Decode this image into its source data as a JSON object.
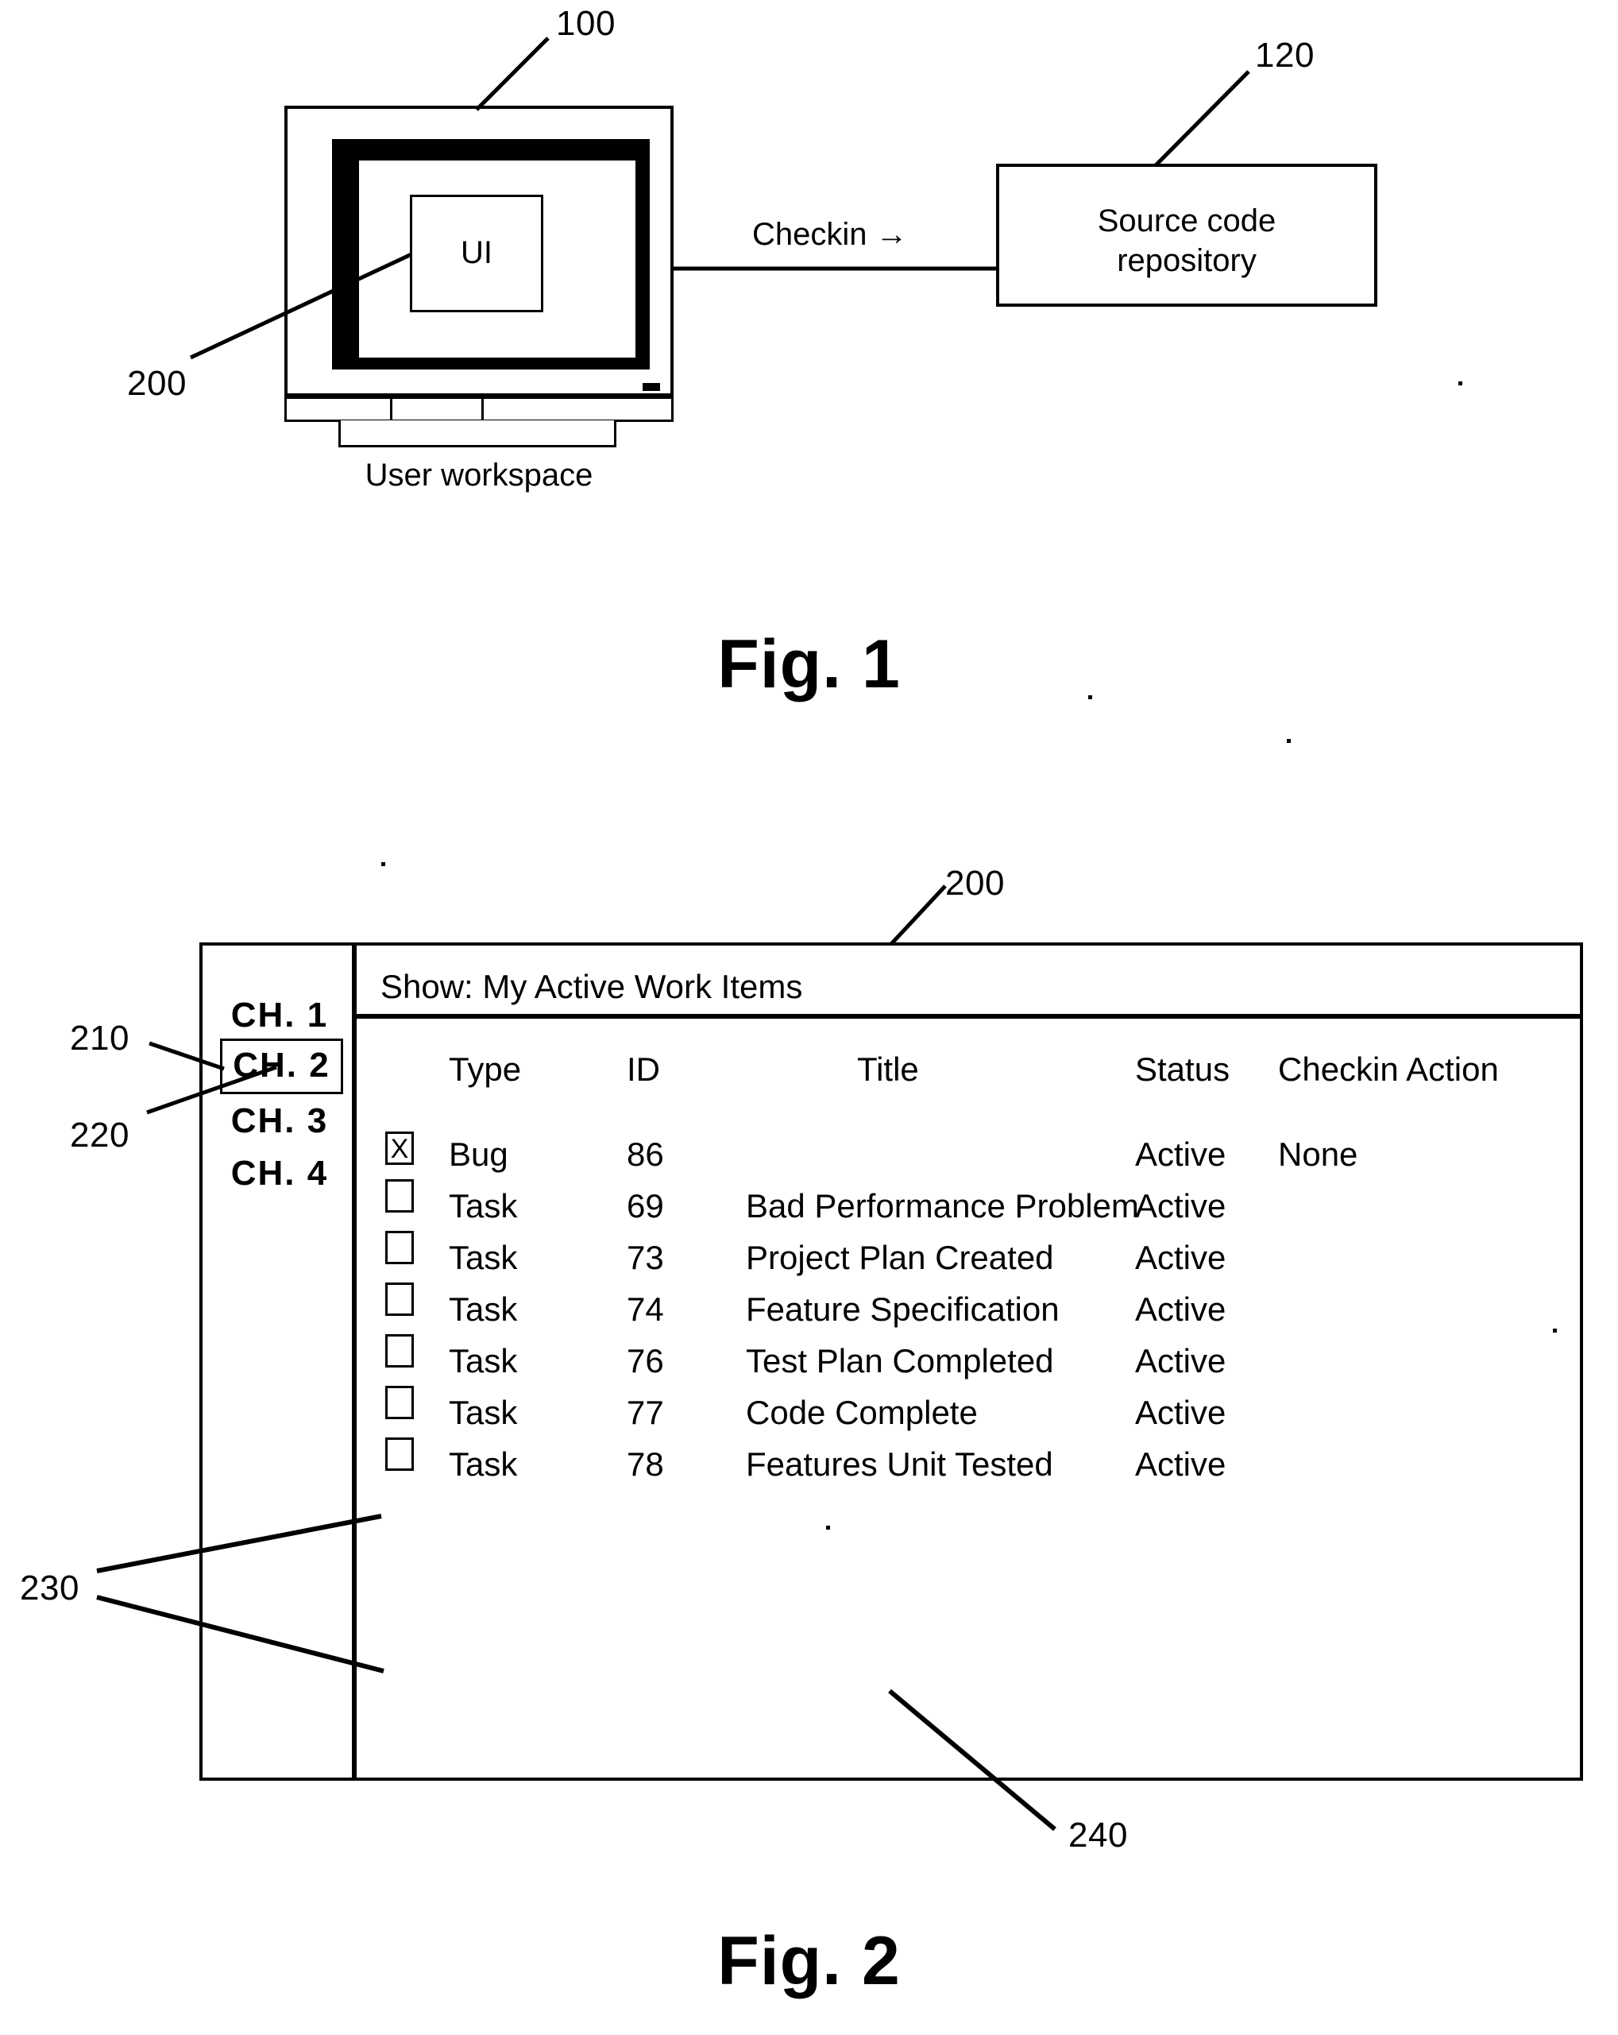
{
  "figures": [
    {
      "id": "fig-1",
      "caption": "Fig. 1",
      "reference_numbers": [
        "100",
        "120",
        "200"
      ],
      "nodes": {
        "workspace": {
          "ref": "100",
          "screen_label": "UI",
          "screen_ref": "200",
          "caption": "User workspace"
        },
        "repository": {
          "ref": "120",
          "line1": "Source code",
          "line2": "repository"
        },
        "connector": {
          "label": "Checkin →"
        }
      }
    },
    {
      "id": "fig-2",
      "caption": "Fig. 2",
      "reference_numbers": [
        "200",
        "210",
        "220",
        "230",
        "240"
      ],
      "window": {
        "ref": "200",
        "sidebar": {
          "ref_selected_box": "210",
          "ref_selected_item": "220",
          "items": [
            {
              "label": "CH. 1",
              "selected": false
            },
            {
              "label": "CH. 2",
              "selected": true
            },
            {
              "label": "CH. 3",
              "selected": false
            },
            {
              "label": "CH. 4",
              "selected": false
            }
          ]
        },
        "show_bar": {
          "text": "Show: My Active Work Items"
        },
        "table": {
          "ref_checkbox_column": "230",
          "ref_title_cell": "240",
          "columns": [
            "Type",
            "ID",
            "Title",
            "Status",
            "Checkin Action"
          ],
          "rows": [
            {
              "checked": true,
              "check_mark": "X",
              "type": "Bug",
              "id": "86",
              "title": "",
              "status": "Active",
              "action": "None"
            },
            {
              "checked": false,
              "check_mark": "",
              "type": "Task",
              "id": "69",
              "title": "Bad Performance Problem",
              "status": "Active",
              "action": ""
            },
            {
              "checked": false,
              "check_mark": "",
              "type": "Task",
              "id": "73",
              "title": "Project Plan Created",
              "status": "Active",
              "action": ""
            },
            {
              "checked": false,
              "check_mark": "",
              "type": "Task",
              "id": "74",
              "title": "Feature Specification",
              "status": "Active",
              "action": ""
            },
            {
              "checked": false,
              "check_mark": "",
              "type": "Task",
              "id": "76",
              "title": "Test Plan Completed",
              "status": "Active",
              "action": ""
            },
            {
              "checked": false,
              "check_mark": "",
              "type": "Task",
              "id": "77",
              "title": "Code Complete",
              "status": "Active",
              "action": ""
            },
            {
              "checked": false,
              "check_mark": "",
              "type": "Task",
              "id": "78",
              "title": "Features Unit Tested",
              "status": "Active",
              "action": ""
            }
          ]
        }
      }
    }
  ],
  "colors": {
    "ink": "#000000",
    "paper": "#ffffff"
  }
}
